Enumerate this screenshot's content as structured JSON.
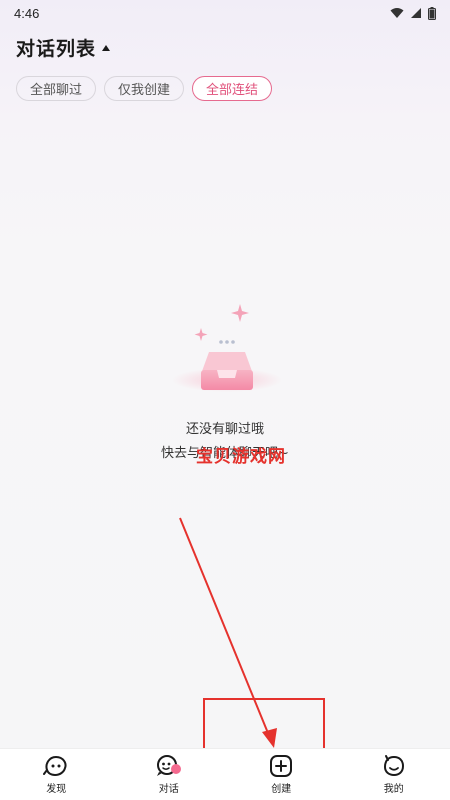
{
  "status_bar": {
    "time": "4:46",
    "icons": [
      "wifi-icon",
      "signal-icon",
      "battery-icon"
    ]
  },
  "header": {
    "title": "对话列表"
  },
  "filters": [
    {
      "label": "全部聊过",
      "active": false
    },
    {
      "label": "仅我创建",
      "active": false
    },
    {
      "label": "全部连结",
      "active": true
    }
  ],
  "empty_state": {
    "line1": "还没有聊过哦",
    "line2": "快去与智能体聊天吧~"
  },
  "watermark": "宝贝游戏网",
  "bottom_nav": [
    {
      "label": "发现",
      "icon": "discover-icon"
    },
    {
      "label": "对话",
      "icon": "chat-icon"
    },
    {
      "label": "创建",
      "icon": "create-icon"
    },
    {
      "label": "我的",
      "icon": "profile-icon"
    }
  ],
  "colors": {
    "accent": "#e0517b",
    "annotation": "#e5322d"
  }
}
